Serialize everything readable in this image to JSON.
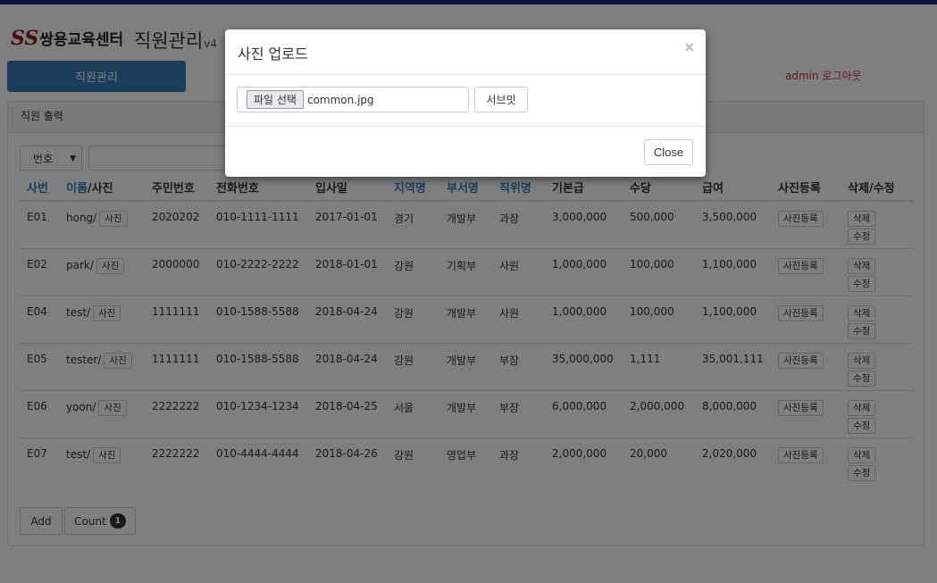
{
  "header": {
    "logo_mark": "SS",
    "logo_text": "쌍용교육센터",
    "app_title": "직원관리",
    "version": "v4",
    "nav_button": "직원관리",
    "admin_label": "admin 로그아웃"
  },
  "panel": {
    "title": "직원 출력",
    "search_select": "번호",
    "add_label": "Add",
    "count_label": "Count",
    "count_value": "1"
  },
  "table": {
    "headers": {
      "id": "사번",
      "name": "이름",
      "name_suffix": "/사진",
      "ssn": "주민번호",
      "phone": "전화번호",
      "hire": "입사일",
      "region": "지역명",
      "dept": "부서명",
      "position": "직위명",
      "base": "기본급",
      "allowance": "수당",
      "salary": "급여",
      "photo_reg": "사진등록",
      "actions": "삭제/수정"
    },
    "photo_btn": "사진",
    "photo_reg_btn": "사진등록",
    "delete_btn": "삭제",
    "edit_btn": "수정",
    "rows": [
      {
        "id": "E01",
        "name": "hong/",
        "ssn": "2020202",
        "phone": "010-1111-1111",
        "hire": "2017-01-01",
        "region": "경기",
        "dept": "개발부",
        "position": "과장",
        "base": "3,000,000",
        "allowance": "500,000",
        "salary": "3,500,000"
      },
      {
        "id": "E02",
        "name": "park/",
        "ssn": "2000000",
        "phone": "010-2222-2222",
        "hire": "2018-01-01",
        "region": "강원",
        "dept": "기획부",
        "position": "사원",
        "base": "1,000,000",
        "allowance": "100,000",
        "salary": "1,100,000"
      },
      {
        "id": "E04",
        "name": "test/",
        "ssn": "1111111",
        "phone": "010-1588-5588",
        "hire": "2018-04-24",
        "region": "강원",
        "dept": "개발부",
        "position": "사원",
        "base": "1,000,000",
        "allowance": "100,000",
        "salary": "1,100,000"
      },
      {
        "id": "E05",
        "name": "tester/",
        "ssn": "1111111",
        "phone": "010-1588-5588",
        "hire": "2018-04-24",
        "region": "강원",
        "dept": "개발부",
        "position": "부장",
        "base": "35,000,000",
        "allowance": "1,111",
        "salary": "35,001,111"
      },
      {
        "id": "E06",
        "name": "yoon/",
        "ssn": "2222222",
        "phone": "010-1234-1234",
        "hire": "2018-04-25",
        "region": "서울",
        "dept": "개발부",
        "position": "부장",
        "base": "6,000,000",
        "allowance": "2,000,000",
        "salary": "8,000,000"
      },
      {
        "id": "E07",
        "name": "test/",
        "ssn": "2222222",
        "phone": "010-4444-4444",
        "hire": "2018-04-26",
        "region": "강원",
        "dept": "영업부",
        "position": "과장",
        "base": "2,000,000",
        "allowance": "20,000",
        "salary": "2,020,000"
      }
    ]
  },
  "modal": {
    "title": "사진 업로드",
    "close_x": "×",
    "file_button": "파일 선택",
    "file_name": "common.jpg",
    "submit_label": "서브밋",
    "close_label": "Close"
  }
}
